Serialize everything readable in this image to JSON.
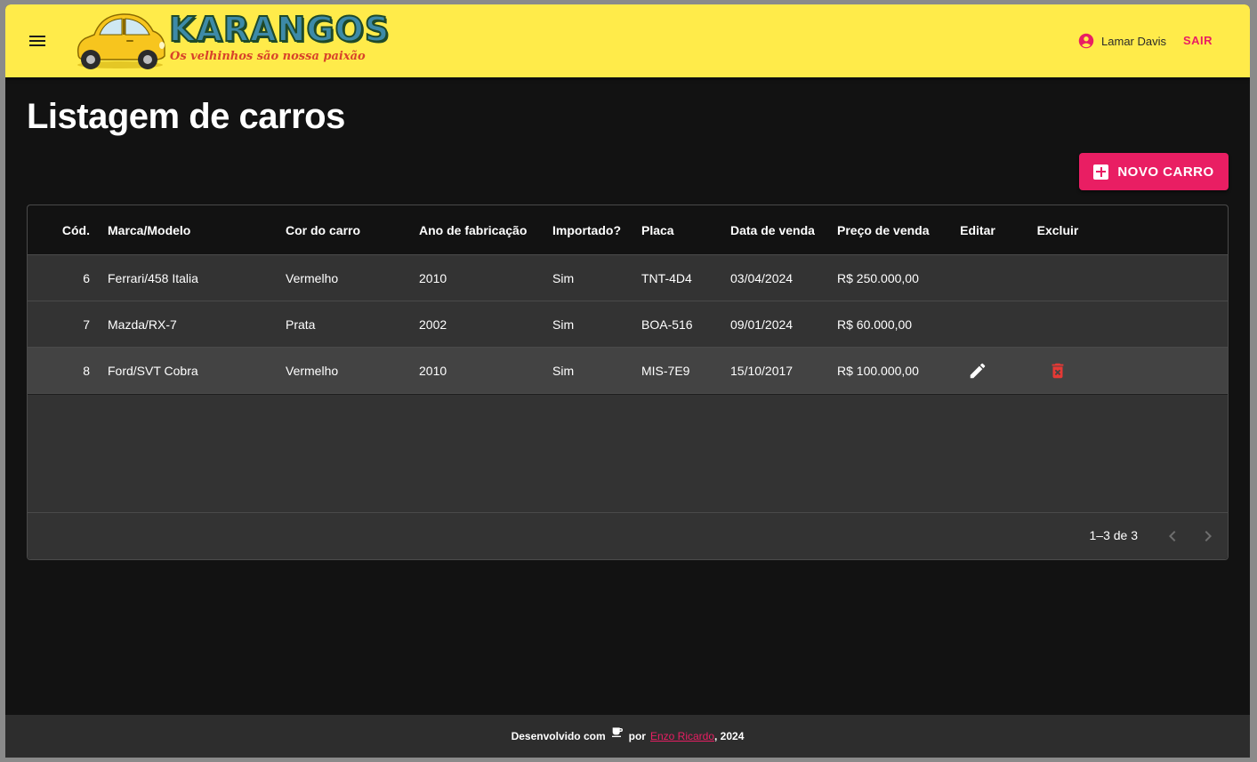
{
  "header": {
    "logo_title": "KARANGOS",
    "logo_subtitle": "Os velhinhos são nossa paixão",
    "user_name": "Lamar Davis",
    "logout_label": "SAIR"
  },
  "page": {
    "title": "Listagem de carros",
    "new_button_label": "NOVO CARRO"
  },
  "table": {
    "columns": [
      "Cód.",
      "Marca/Modelo",
      "Cor do carro",
      "Ano de fabricação",
      "Importado?",
      "Placa",
      "Data de venda",
      "Preço de venda",
      "Editar",
      "Excluir"
    ],
    "rows": [
      {
        "cod": "6",
        "marca": "Ferrari/458 Italia",
        "cor": "Vermelho",
        "ano": "2010",
        "importado": "Sim",
        "placa": "TNT-4D4",
        "data": "03/04/2024",
        "preco": "R$ 250.000,00"
      },
      {
        "cod": "7",
        "marca": "Mazda/RX-7",
        "cor": "Prata",
        "ano": "2002",
        "importado": "Sim",
        "placa": "BOA-516",
        "data": "09/01/2024",
        "preco": "R$ 60.000,00"
      },
      {
        "cod": "8",
        "marca": "Ford/SVT Cobra",
        "cor": "Vermelho",
        "ano": "2010",
        "importado": "Sim",
        "placa": "MIS-7E9",
        "data": "15/10/2017",
        "preco": "R$ 100.000,00"
      }
    ],
    "pagination": "1–3 de 3"
  },
  "footer": {
    "prefix": "Desenvolvido com",
    "by": "por",
    "author": "Enzo Ricardo",
    "year_suffix": ", 2024"
  },
  "colors": {
    "appbar": "#ffeb4a",
    "accent": "#e91e63",
    "background": "#121212",
    "row": "#333333"
  }
}
